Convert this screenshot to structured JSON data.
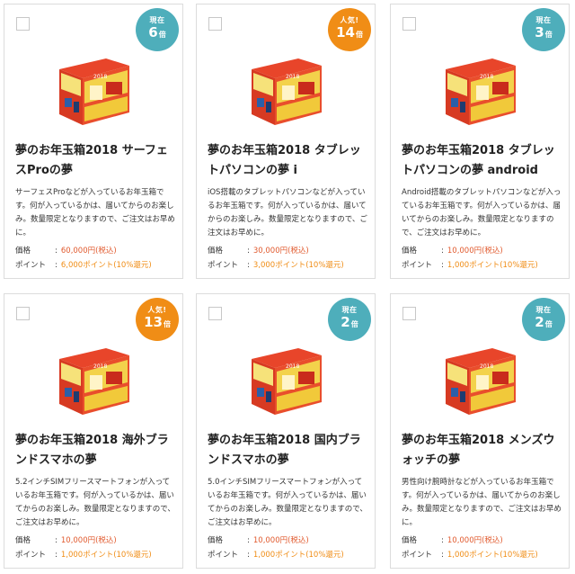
{
  "labels": {
    "price_label": "価格",
    "point_label": "ポイント",
    "separator": ":"
  },
  "colors": {
    "badge_current": "#4eaebb",
    "badge_popular": "#f08d16",
    "price_text": "#e15a2e",
    "point_text": "#f08d16"
  },
  "products": [
    {
      "badge": {
        "type": "current",
        "label": "現在",
        "value": "6",
        "unit": "倍"
      },
      "title": "夢のお年玉箱2018 サーフェスProの夢",
      "description": "サーフェスProなどが入っているお年玉箱です。何が入っているかは、届いてからのお楽しみ。数量限定となりますので、ご注文はお早めに。",
      "price": "60,000円(税込)",
      "point": "6,000ポイント(10%還元)"
    },
    {
      "badge": {
        "type": "popular",
        "label": "人気!",
        "value": "14",
        "unit": "倍"
      },
      "title": "夢のお年玉箱2018 タブレットパソコンの夢 i",
      "description": "iOS搭載のタブレットパソコンなどが入っているお年玉箱です。何が入っているかは、届いてからのお楽しみ。数量限定となりますので、ご注文はお早めに。",
      "price": "30,000円(税込)",
      "point": "3,000ポイント(10%還元)"
    },
    {
      "badge": {
        "type": "current",
        "label": "現在",
        "value": "3",
        "unit": "倍"
      },
      "title": "夢のお年玉箱2018 タブレットパソコンの夢 android",
      "description": "Android搭載のタブレットパソコンなどが入っているお年玉箱です。何が入っているかは、届いてからのお楽しみ。数量限定となりますので、ご注文はお早めに。",
      "price": "10,000円(税込)",
      "point": "1,000ポイント(10%還元)"
    },
    {
      "badge": {
        "type": "popular",
        "label": "人気!",
        "value": "13",
        "unit": "倍"
      },
      "title": "夢のお年玉箱2018 海外ブランドスマホの夢",
      "description": "5.2インチSIMフリースマートフォンが入っているお年玉箱です。何が入っているかは、届いてからのお楽しみ。数量限定となりますので、ご注文はお早めに。",
      "price": "10,000円(税込)",
      "point": "1,000ポイント(10%還元)"
    },
    {
      "badge": {
        "type": "current",
        "label": "現在",
        "value": "2",
        "unit": "倍"
      },
      "title": "夢のお年玉箱2018 国内ブランドスマホの夢",
      "description": "5.0インチSIMフリースマートフォンが入っているお年玉箱です。何が入っているかは、届いてからのお楽しみ。数量限定となりますので、ご注文はお早めに。",
      "price": "10,000円(税込)",
      "point": "1,000ポイント(10%還元)"
    },
    {
      "badge": {
        "type": "current",
        "label": "現在",
        "value": "2",
        "unit": "倍"
      },
      "title": "夢のお年玉箱2018 メンズウォッチの夢",
      "description": "男性向け腕時計などが入っているお年玉箱です。何が入っているかは、届いてからのお楽しみ。数量限定となりますので、ご注文はお早めに。",
      "price": "10,000円(税込)",
      "point": "1,000ポイント(10%還元)"
    }
  ]
}
